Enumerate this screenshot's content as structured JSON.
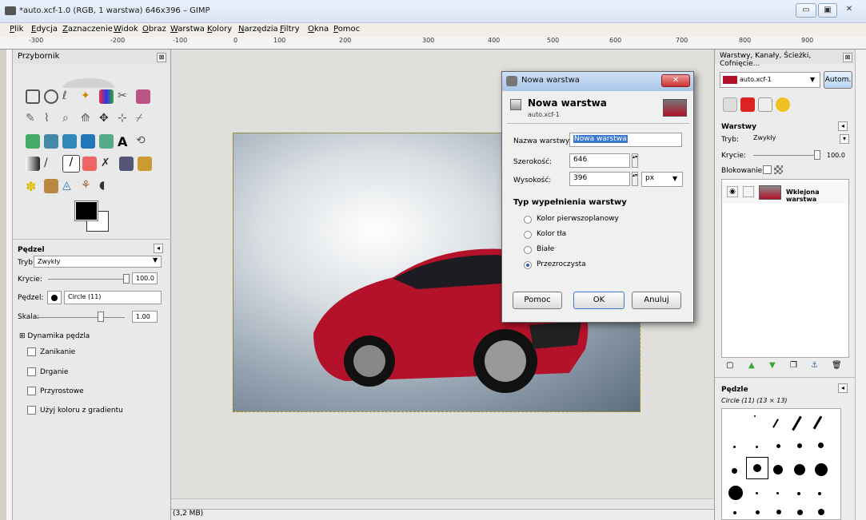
{
  "window": {
    "title": "*auto.xcf-1.0 (RGB, 1 warstwa) 646x396 – GIMP"
  },
  "menu": [
    "Plik",
    "Edycja",
    "Zaznaczenie",
    "Widok",
    "Obraz",
    "Warstwa",
    "Kolory",
    "Narzędzia",
    "Filtry",
    "Okna",
    "Pomoc"
  ],
  "ruler": [
    "-300",
    "-200",
    "-100",
    "0",
    "100",
    "200",
    "300",
    "400",
    "500",
    "600",
    "700",
    "800",
    "900"
  ],
  "toolbox": {
    "title": "Przybornik",
    "brush_section": "Pędzel",
    "mode_label": "Tryb:",
    "mode_value": "Zwykły",
    "opacity_label": "Krycie:",
    "opacity_value": "100.0",
    "brush_label": "Pędzel:",
    "brush_value": "Circle (11)",
    "scale_label": "Skala:",
    "scale_value": "1.00",
    "dynamics": "Dynamika pędzla",
    "options": [
      "Zanikanie",
      "Drganie",
      "Przyrostowe",
      "Użyj koloru z gradientu"
    ]
  },
  "status": {
    "text": "(3,2 MB)"
  },
  "layers_dock": {
    "title": "Warstwy, Kanały, Ścieżki, Cofnięcie...",
    "image_select": "auto.xcf-1",
    "auto_button": "Autom.",
    "section": "Warstwy",
    "mode_label": "Tryb:",
    "mode_value": "Zwykły",
    "opacity_label": "Krycie:",
    "opacity_value": "100.0",
    "lock_label": "Blokowanie:",
    "layer_name": "Wklejona warstwa",
    "brushes_title": "Pędzle",
    "brush_info": "Circle (11) (13 × 13)"
  },
  "dialog": {
    "title": "Nowa warstwa",
    "heading": "Nowa warstwa",
    "subheading": "auto.xcf-1",
    "name_label": "Nazwa warstwy:",
    "name_value": "Nowa warstwa",
    "width_label": "Szerokość:",
    "width_value": "646",
    "height_label": "Wysokość:",
    "height_value": "396",
    "unit": "px",
    "fill_title": "Typ wypełnienia warstwy",
    "fill_options": [
      "Kolor pierwszoplanowy",
      "Kolor tła",
      "Białe",
      "Przezroczysta"
    ],
    "help_button": "Pomoc",
    "ok_button": "OK",
    "cancel_button": "Anuluj"
  }
}
